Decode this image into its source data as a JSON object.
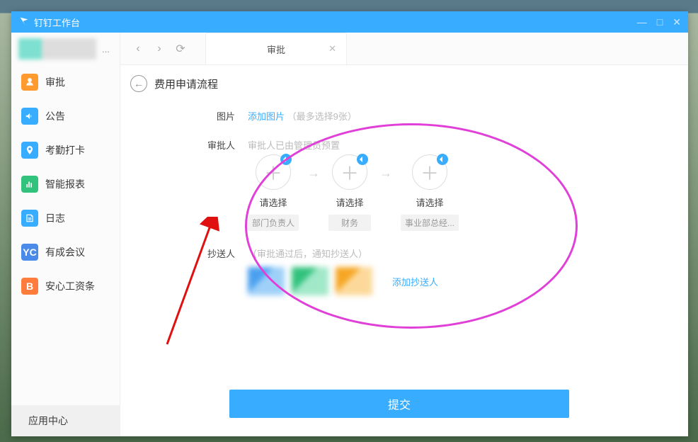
{
  "window": {
    "title": "钉钉工作台"
  },
  "sidebar": {
    "user_more": "...",
    "items": [
      {
        "label": "审批"
      },
      {
        "label": "公告"
      },
      {
        "label": "考勤打卡"
      },
      {
        "label": "智能报表"
      },
      {
        "label": "日志"
      },
      {
        "label": "有成会议"
      },
      {
        "label": "安心工资条"
      }
    ],
    "app_center": "应用中心"
  },
  "tab": {
    "label": "审批"
  },
  "page": {
    "title": "费用申请流程"
  },
  "form": {
    "image": {
      "label": "图片",
      "link": "添加图片",
      "hint": "（最多选择9张）"
    },
    "approver": {
      "label": "审批人",
      "hint": "审批人已由管理员预置",
      "nodes": [
        {
          "placeholder": "请选择",
          "role": "部门负责人"
        },
        {
          "placeholder": "请选择",
          "role": "财务"
        },
        {
          "placeholder": "请选择",
          "role": "事业部总经..."
        }
      ]
    },
    "cc": {
      "label": "抄送人",
      "hint": "（审批通过后，通知抄送人）",
      "add_link": "添加抄送人"
    },
    "submit": "提交"
  }
}
